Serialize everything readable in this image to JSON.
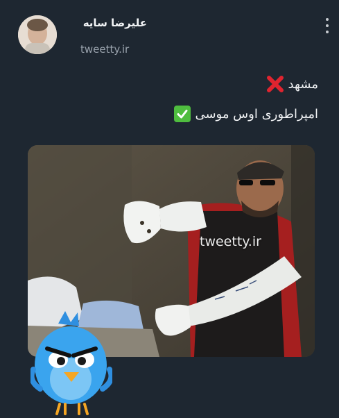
{
  "tweet": {
    "author_name": "علیرضا سایه",
    "handle": "tweetty.ir",
    "line1_text": "مشهد",
    "line2_text": "امپراطوری اوس موسی"
  },
  "media": {
    "watermark": "tweetty.ir"
  },
  "icons": {
    "overflow": "more-vertical-icon",
    "line1_emoji": "cross-mark-icon",
    "line2_emoji": "check-mark-icon",
    "sticker": "angry-blue-bird-mascot"
  },
  "colors": {
    "background": "#1e2731",
    "text_primary": "#f1f3f5",
    "text_secondary": "#9aa3ad",
    "cross_red": "#e0242f",
    "check_green": "#4fbd3f"
  }
}
